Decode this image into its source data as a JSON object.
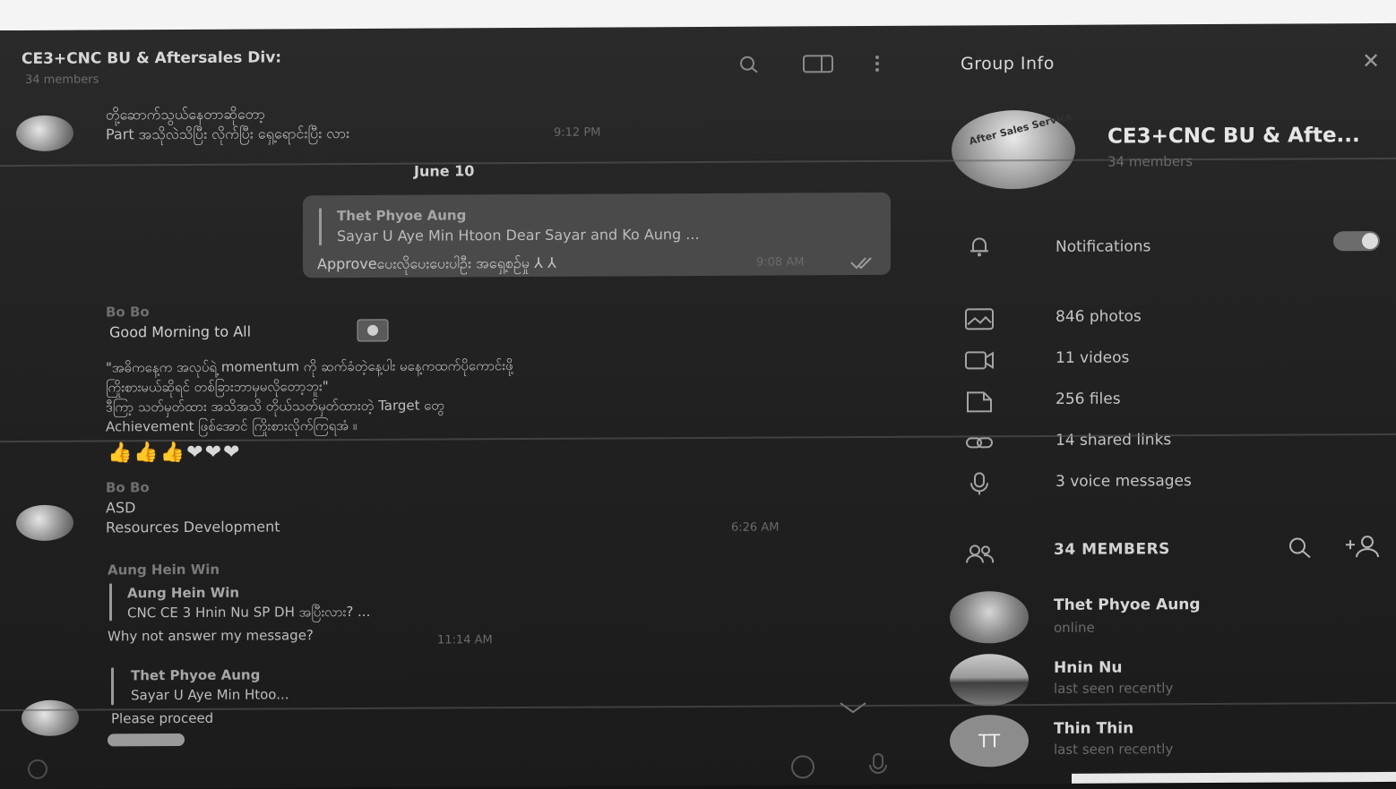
{
  "chat": {
    "title": "CE3+CNC BU & Aftersales Div:",
    "subtitle": "34 members",
    "messages": {
      "m1_line1": "တို့ဆောက်သွယ်နေတာဆိုတော့",
      "m1_line2": "Part အသိုလဲသိပြီး လိုက်ပြီး ရှေ့ရောင်းပြီး လား",
      "m1_time": "9:12 PM",
      "date": "June 10",
      "bubble_sender": "Thet Phyoe Aung",
      "bubble_quote": "Sayar U Aye Min Htoon Dear Sayar and Ko Aung ...",
      "bubble_text": "Approveပေးလိုပေးပေးပါဦး အရှေ့စဉ်မှု ⅄ ⅄",
      "bubble_time": "9:08 AM",
      "bobo_sender": "Bo Bo",
      "bobo_greeting": "Good Morning to All",
      "bobo_p1": "\"အဓိကနေ့က အလုပ်ရဲ့ momentum ကို ဆက်ခံတဲ့နေ့ပါး မနေ့ကထက်ပိုကောင်းဖို့",
      "bobo_p2": "ကြိုးစားမယ်ဆိုရင် တစ်ခြားဘာမှမလိုတော့ဘူး\"",
      "bobo_p3": "ဒီကြာ့ သတ်မှတ်ထား အသိအသိ တိုယ်သတ်မှတ်ထားတဲ့ Target တွေ",
      "bobo_p4": "Achievement ဖြစ်အောင် ကြိုးစားလိုက်ကြရအံ ။",
      "bobo_emoji": "👍👍👍❤❤❤",
      "bobo2_sender": "Bo Bo",
      "bobo2_line1": "ASD",
      "bobo2_line2": "Resources Development",
      "bobo2_time": "6:26 AM",
      "ahw_sender": "Aung Hein Win",
      "ahw_quote_name": "Aung Hein Win",
      "ahw_quote_text": "CNC CE 3 Hnin Nu SP DH အပြီးလား? ...",
      "ahw_text": "Why not answer my message?",
      "ahw_time": "11:14 AM",
      "tpa_quote_name": "Thet Phyoe Aung",
      "tpa_quote_text": "Sayar U Aye Min Htoo...",
      "tpa_text": "Please proceed"
    }
  },
  "info": {
    "title": "Group Info",
    "group_name": "CE3+CNC BU & Afte...",
    "group_members": "34 members",
    "avatar_text": "After Sales Service",
    "notifications_label": "Notifications",
    "notifications_on": true,
    "rows": {
      "photos": "846 photos",
      "videos": "11 videos",
      "files": "256 files",
      "links": "14 shared links",
      "voice": "3 voice messages"
    },
    "members_header": "34 MEMBERS",
    "members": [
      {
        "name": "Thet Phyoe Aung",
        "status": "online"
      },
      {
        "name": "Hnin Nu",
        "status": "last seen recently"
      },
      {
        "name": "Thin Thin",
        "status": "last seen recently",
        "initials": "TT"
      }
    ]
  },
  "icons": [
    "search-icon",
    "columns-icon",
    "more-icon",
    "close-icon",
    "bell-icon",
    "photo-icon",
    "video-icon",
    "file-icon",
    "link-icon",
    "mic-icon",
    "members-icon",
    "add-member-icon"
  ]
}
